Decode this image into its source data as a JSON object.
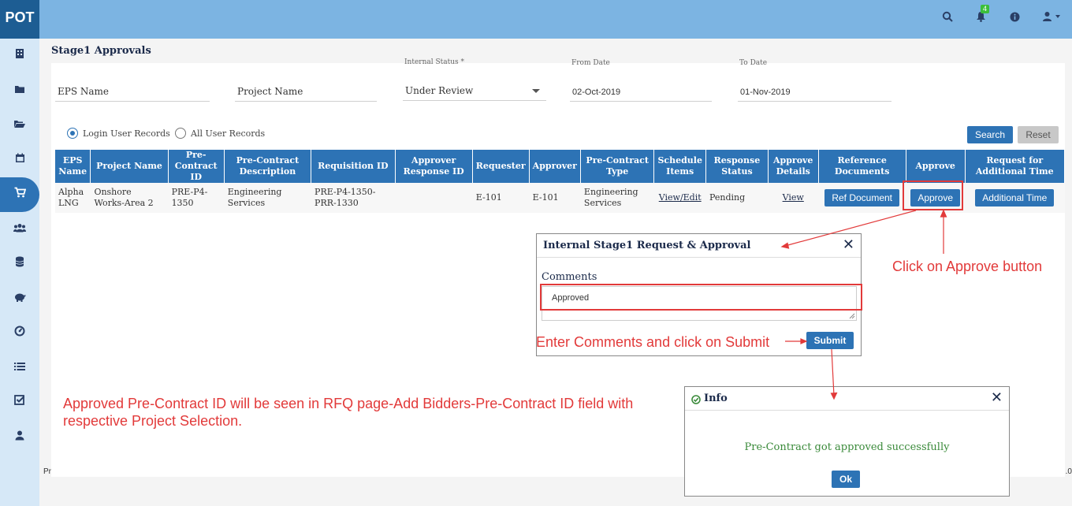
{
  "app": {
    "logo": "POT"
  },
  "header": {
    "notification_count": "4"
  },
  "icons": {
    "search": "search-icon",
    "bell": "bell-icon",
    "info": "info-icon",
    "user": "user-icon",
    "sidebar": [
      "building-icon",
      "folder-icon",
      "folder-open-icon",
      "calendar-icon",
      "cart-icon",
      "users-icon",
      "database-icon",
      "piggy-bank-icon",
      "dashboard-icon",
      "list-icon",
      "check-square-icon",
      "person-icon"
    ]
  },
  "colors": {
    "topbar": "#7cb4e2",
    "brand": "#1d5d93",
    "accent": "#2d73b5",
    "annotation": "#e23a3a",
    "success": "#3a8a3a"
  },
  "page": {
    "title": "Stage1 Approvals"
  },
  "filters": {
    "eps_name": {
      "value": "EPS Name"
    },
    "project_name": {
      "value": "Project Name"
    },
    "internal_status": {
      "label": "Internal Status *",
      "value": "Under Review"
    },
    "from_date": {
      "label": "From Date",
      "value": "02-Oct-2019"
    },
    "to_date": {
      "label": "To Date",
      "value": "01-Nov-2019"
    }
  },
  "record_filter": {
    "login_user": "Login User Records",
    "all_user": "All User Records",
    "selected": "login_user"
  },
  "actions": {
    "search": "Search",
    "reset": "Reset"
  },
  "table": {
    "headers": {
      "eps_name": "EPS Name",
      "project_name": "Project Name",
      "pre_contract_id": "Pre-Contract ID",
      "pre_contract_desc": "Pre-Contract Description",
      "requisition_id": "Requisition ID",
      "approver_response_id": "Approver Response ID",
      "requester": "Requester",
      "approver": "Approver",
      "pre_contract_type": "Pre-Contract Type",
      "schedule_items": "Schedule Items",
      "response_status": "Response Status",
      "approve_details": "Approve Details",
      "reference_documents": "Reference Documents",
      "approve": "Approve",
      "request_additional_time": "Request for Additional Time"
    },
    "rows": [
      {
        "eps_name": "Alpha LNG",
        "project_name": "Onshore Works-Area 2",
        "pre_contract_id": "PRE-P4-1350",
        "pre_contract_desc": "Engineering Services",
        "requisition_id": "PRE-P4-1350-PRR-1330",
        "approver_response_id": "",
        "requester": "E-101",
        "approver": "E-101",
        "pre_contract_type": "Engineering Services",
        "schedule_items": "View/Edit",
        "response_status": "Pending",
        "approve_details": "View",
        "ref_document": "Ref Document",
        "approve": "Approve",
        "additional_time": "Additional Time"
      }
    ]
  },
  "footer": {
    "left_fragment": "Pr",
    "right_fragment": ".0"
  },
  "approval_modal": {
    "title": "Internal Stage1 Request & Approval",
    "close": "✕",
    "comments_label": "Comments",
    "comments_value": "Approved",
    "submit": "Submit"
  },
  "info_modal": {
    "title": "Info",
    "close": "✕",
    "message": "Pre-Contract got approved successfully",
    "ok": "Ok"
  },
  "annotations": {
    "approve_hint": "Click on Approve button",
    "submit_hint": "Enter Comments and click on Submit",
    "rfq_note_line1": "Approved Pre-Contract ID will be seen in RFQ page-Add Bidders-Pre-Contract ID field with",
    "rfq_note_line2": "respective Project Selection."
  }
}
